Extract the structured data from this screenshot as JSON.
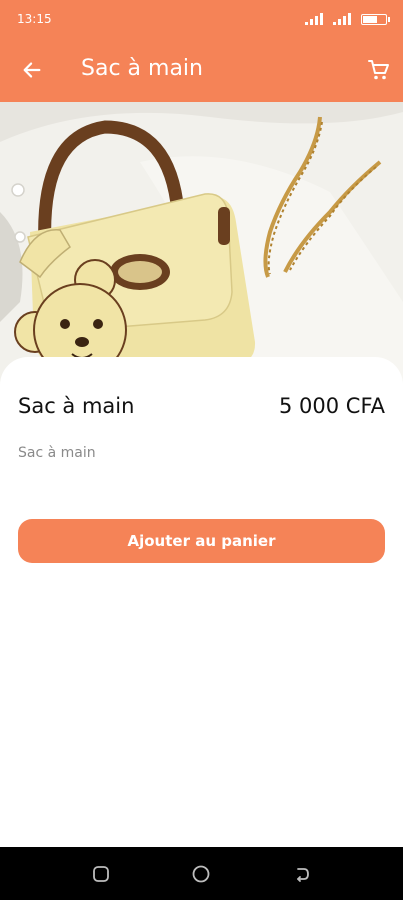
{
  "status_bar": {
    "time": "13:15",
    "icons": [
      "signal-icon",
      "signal-icon",
      "battery-icon"
    ]
  },
  "app_bar": {
    "title": "Sac à main",
    "back_icon": "arrow-left-icon",
    "cart_icon": "shopping-cart-icon",
    "background": "#f58357"
  },
  "product": {
    "name": "Sac à main",
    "price": "5 000 CFA",
    "description": "Sac à main",
    "image_subject": "yellow handbag with teddy bear charm and gold chain"
  },
  "actions": {
    "add_to_cart_label": "Ajouter au panier"
  },
  "carousel": {
    "active_index": 0,
    "count": 1
  },
  "colors": {
    "accent": "#f58357",
    "text_primary": "#111111",
    "text_secondary": "#8a8a8a"
  },
  "navigation_bar": {
    "buttons": [
      "recents-icon",
      "home-icon",
      "back-icon"
    ]
  }
}
